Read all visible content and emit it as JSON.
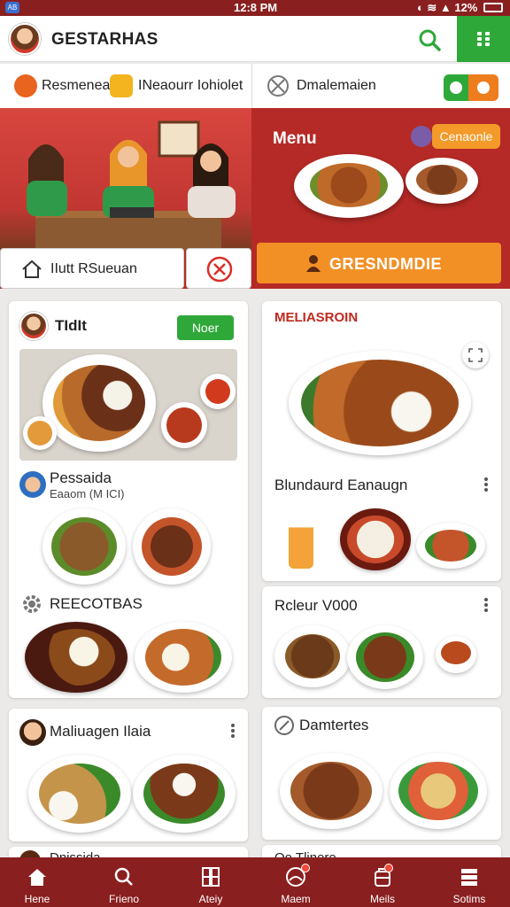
{
  "status_bar": {
    "time": "12:8 PM",
    "battery": "12%"
  },
  "app_bar": {
    "title": "GESTARHAS"
  },
  "filters": {
    "item1": "Resmenea",
    "item2": "INeaourr Iohiolet",
    "item3": "Dmalemaien"
  },
  "hero": {
    "menu_label": "Menu",
    "category_button": "Cenaonle",
    "search_label": "IIutt RSueuan",
    "order_button": "GRESNDMDIE"
  },
  "cards": {
    "c1": {
      "title": "TIdIt",
      "tag": "Noer"
    },
    "c1b": {
      "title": "Pessaida",
      "subtitle": "Eaaom (M ICI)"
    },
    "c1c": {
      "title": "REECOTBAS"
    },
    "c2": {
      "title": "MELIASROIN"
    },
    "c2b": {
      "title": "Blundaurd Eanaugn"
    },
    "c2c": {
      "title": "Rcleur V000"
    },
    "c3": {
      "title": "Maliuagen Ilaia"
    },
    "c3b": {
      "title": "Dnissida"
    },
    "c4": {
      "title": "Damtertes"
    },
    "c4b": {
      "title": "Oo Tlinere"
    }
  },
  "bottom_nav": [
    {
      "label": "Hene",
      "icon": "home-icon"
    },
    {
      "label": "Frieno",
      "icon": "search-icon"
    },
    {
      "label": "Ateiy",
      "icon": "grid-icon"
    },
    {
      "label": "Maem",
      "icon": "profile-icon"
    },
    {
      "label": "Meils",
      "icon": "bag-icon"
    },
    {
      "label": "Sotims",
      "icon": "settings-icon"
    }
  ],
  "colors": {
    "primary": "#8a1f1f",
    "hero": "#b52a26",
    "accent_green": "#2fa83a",
    "accent_orange": "#f29026"
  }
}
